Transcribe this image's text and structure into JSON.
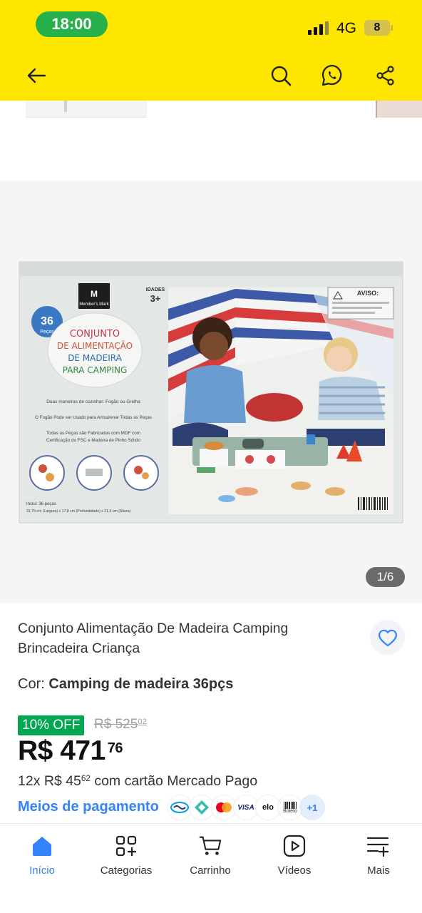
{
  "status_bar": {
    "time": "18:00",
    "network": "4G",
    "battery": "8"
  },
  "header": {
    "icons": [
      "back-arrow-icon",
      "search-icon",
      "whatsapp-share-icon",
      "share-icon"
    ],
    "background_color": "#ffe600"
  },
  "gallery": {
    "counter": "1/6",
    "product_box": {
      "badge_count": "36",
      "badge_unit": "Peças",
      "brand": "Member's Mark",
      "age_label": "IDADES",
      "age_value": "3+",
      "warning": "AVISO:",
      "headline": [
        "CONJUNTO",
        "DE ALIMENTAÇÃO",
        "DE MADEIRA",
        "PARA CAMPING"
      ],
      "line1": "Duas maneiras de cozinhar: Fogão ou Grelha",
      "line2": "O Fogão Pode ser Usado para Armazenar Todas as Peças",
      "line3": "Todas as Peças são Fabricadas com MDF com",
      "line4": "Certificação do FSC e Madeira de Pinho Sólido",
      "includes": "Inclui: 36 peças",
      "dimensions": "31,75 cm (Largura) x 17,8 cm (Profundidade) x 21,6 cm (Altura)"
    }
  },
  "product": {
    "title": "Conjunto Alimentação De Madeira Camping Brincadeira Criança",
    "color_label": "Cor: ",
    "color_value": "Camping de madeira 36pçs",
    "discount": "10% OFF",
    "old_price_main": "R$ 525",
    "old_price_cents": "02",
    "price_main": "R$ 471",
    "price_cents": "76",
    "installments_prefix": "12x R$ 45",
    "installments_cents": "62",
    "installments_suffix": " com cartão Mercado Pago",
    "payment_link": "Meios de pagamento",
    "payment_logos": [
      "mercado-pago",
      "pix",
      "mastercard",
      "VISA",
      "elo",
      "Boleto"
    ],
    "payment_more": "+1"
  },
  "tabbar": {
    "items": [
      {
        "label": "Início",
        "icon": "home-icon",
        "active": true
      },
      {
        "label": "Categorias",
        "icon": "categories-icon",
        "active": false
      },
      {
        "label": "Carrinho",
        "icon": "cart-icon",
        "active": false
      },
      {
        "label": "Vídeos",
        "icon": "video-icon",
        "active": false
      },
      {
        "label": "Mais",
        "icon": "menu-more-icon",
        "active": false
      }
    ]
  },
  "colors": {
    "accent": "#3483fa",
    "discount": "#00a650",
    "header": "#ffe600"
  }
}
